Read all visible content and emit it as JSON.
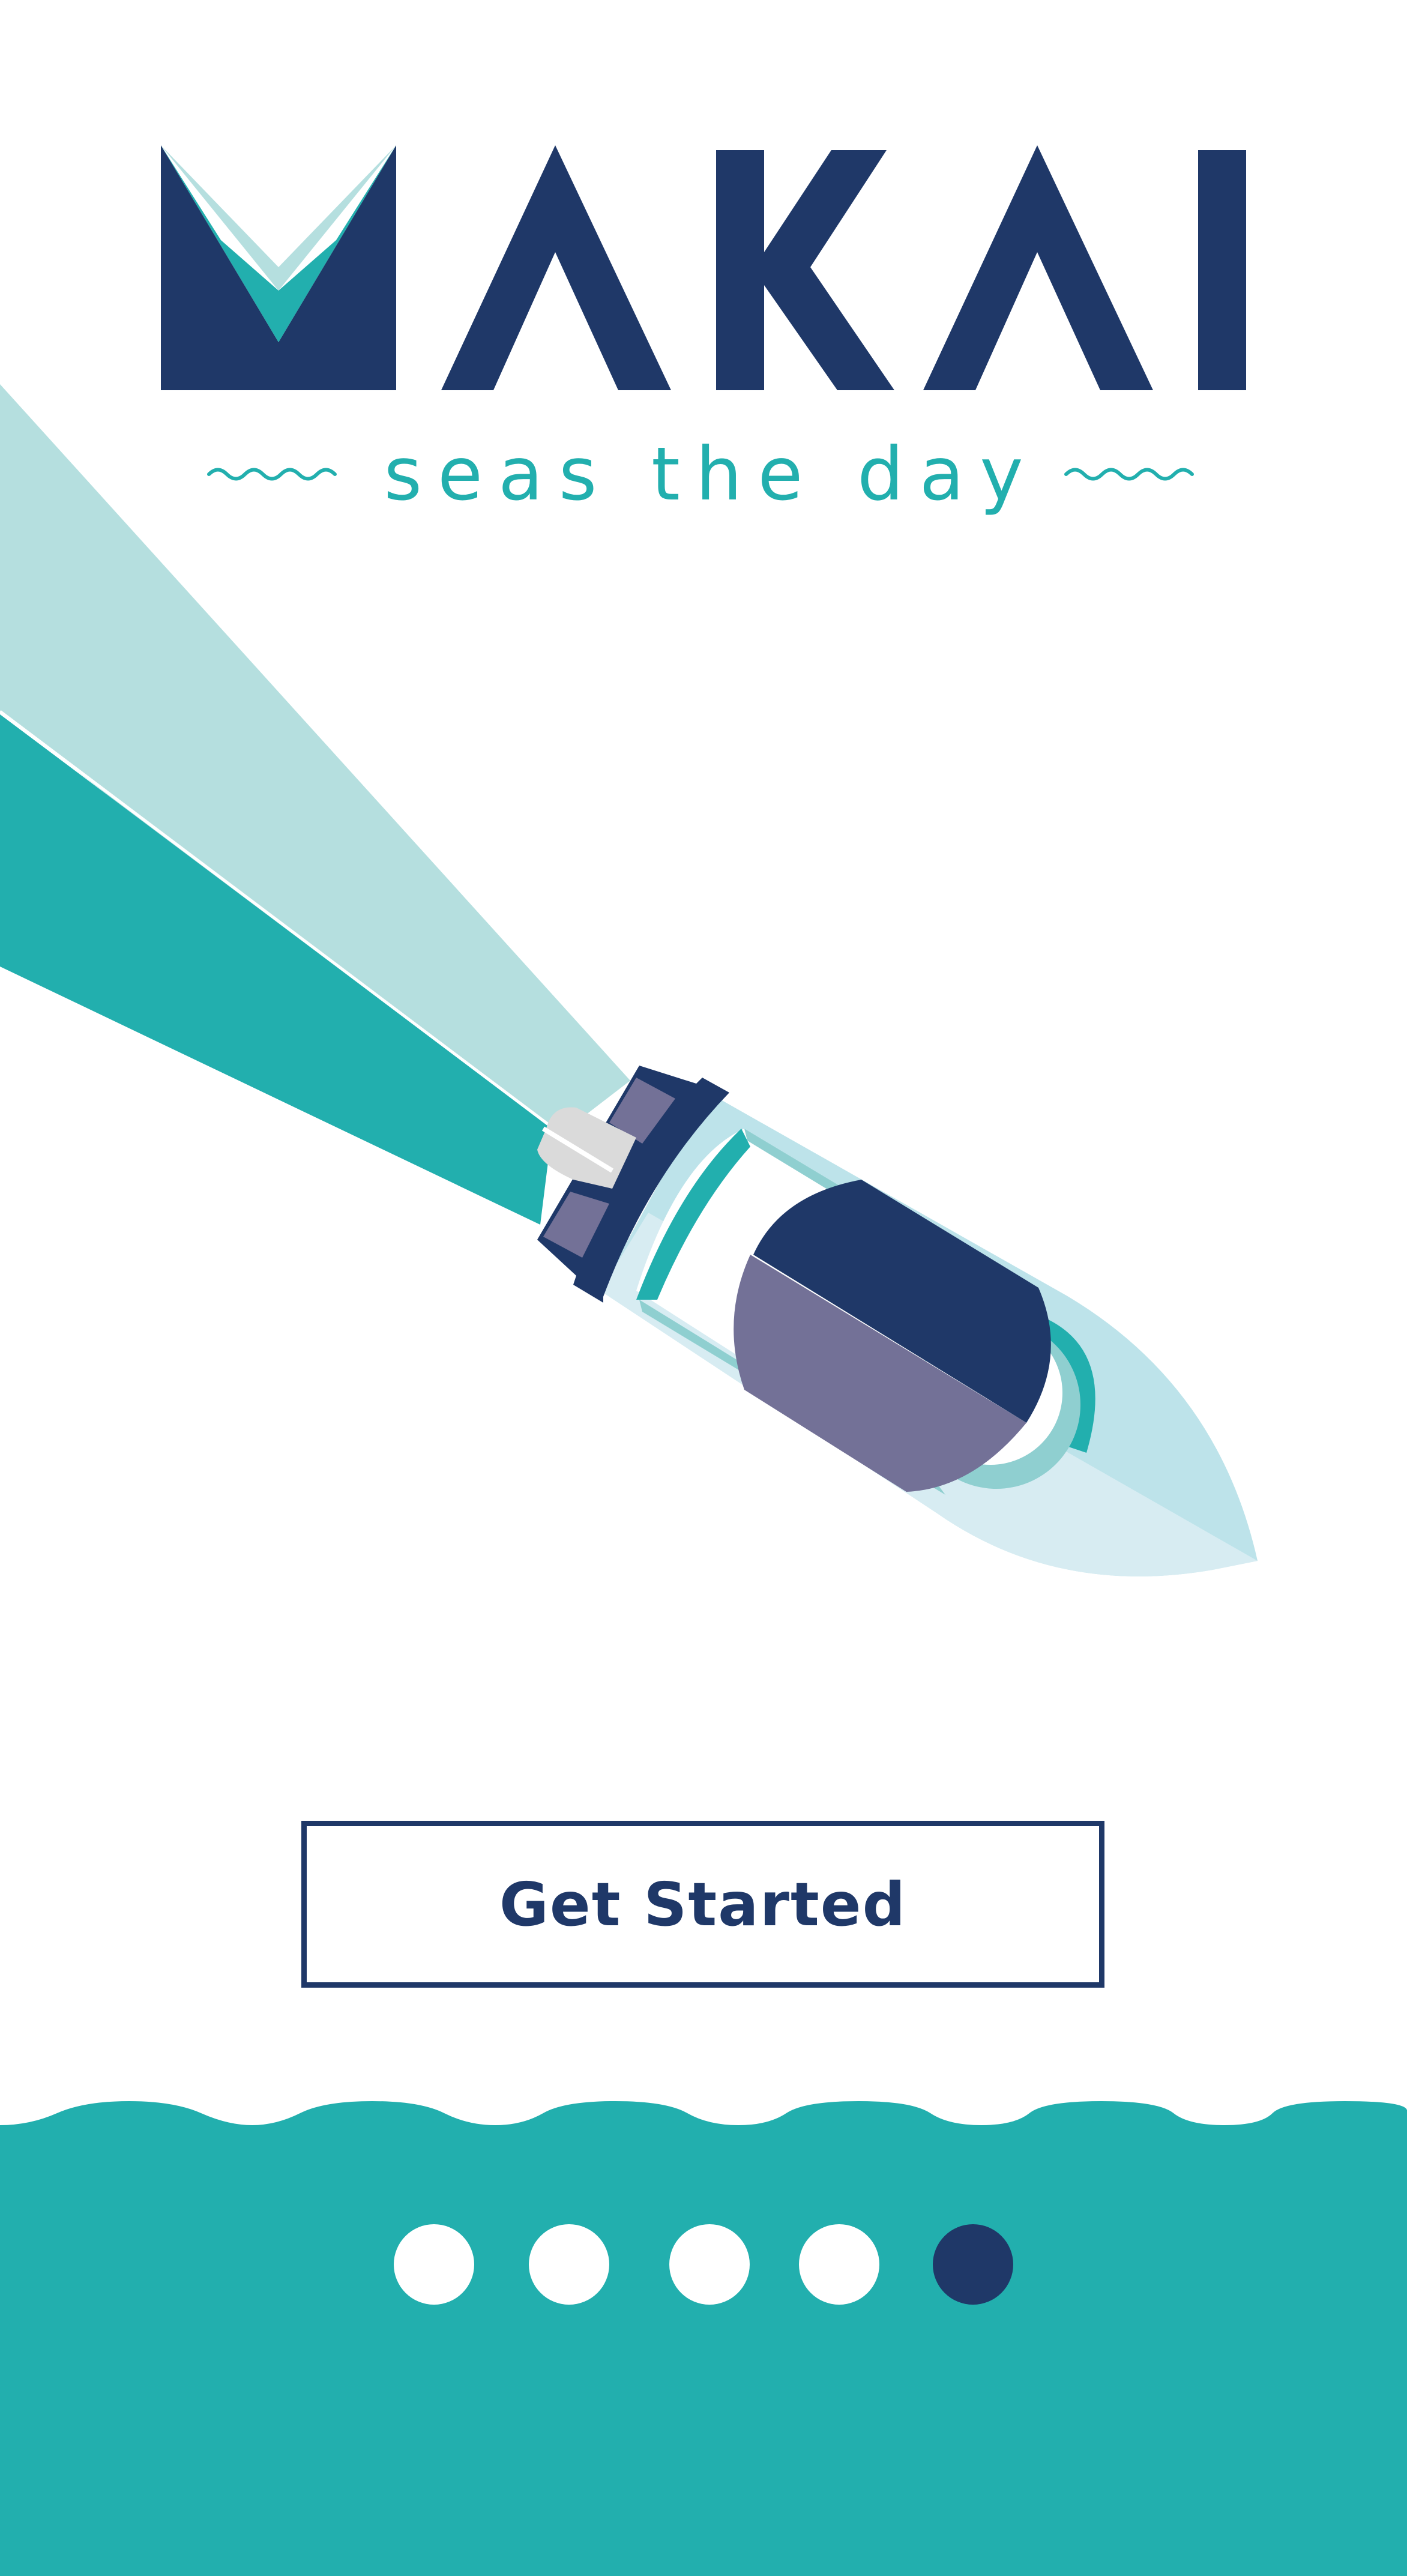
{
  "brand": {
    "name": "MAKAI",
    "tagline": "seas the day",
    "colors": {
      "navy": "#1f3868",
      "teal": "#22afae",
      "light_teal": "#b5dfdf",
      "sky": "#bde3ea",
      "pale_sky": "#d7ecf2",
      "purple": "#737197",
      "white": "#ffffff"
    }
  },
  "cta": {
    "label": "Get Started"
  },
  "pagination": {
    "total": 5,
    "active_index": 4
  },
  "illustration": {
    "subject": "speedboat-from-above",
    "icons": [
      "wave-squiggle-icon",
      "boat-icon",
      "wake-icon"
    ]
  }
}
